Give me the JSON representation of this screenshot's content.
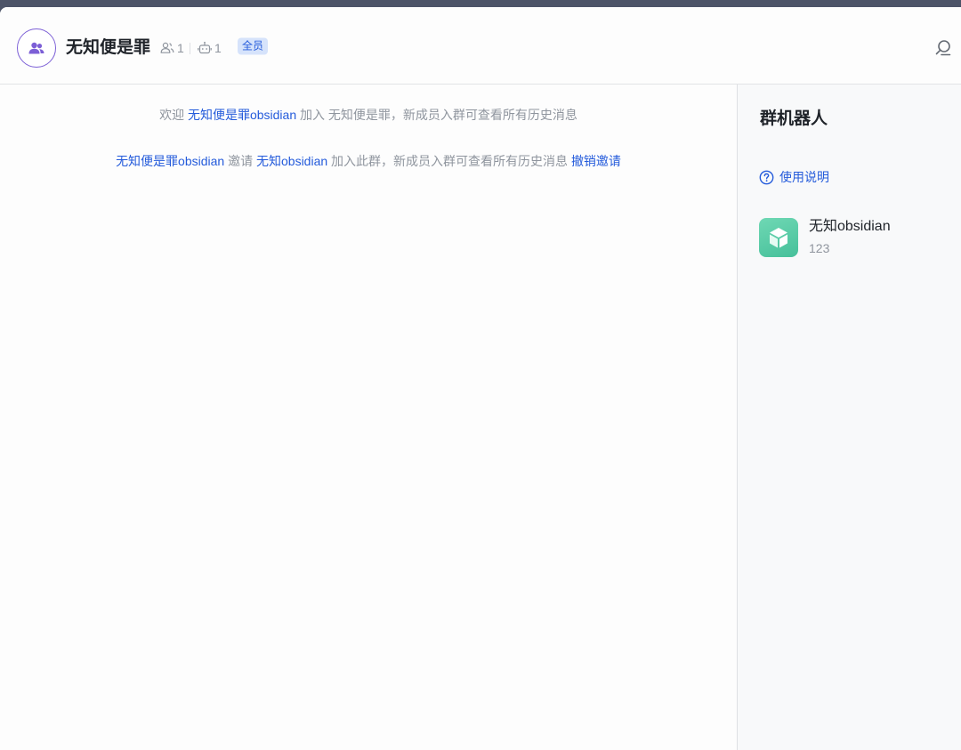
{
  "header": {
    "group_name": "无知便是罪",
    "member_count": "1",
    "bot_count": "1",
    "badge": "全员"
  },
  "chat": {
    "messages": [
      {
        "prefix": "欢迎 ",
        "user": "无知便是罪obsidian",
        "suffix": " 加入 无知便是罪，新成员入群可查看所有历史消息"
      },
      {
        "inviter": "无知便是罪obsidian",
        "invite_word": " 邀请 ",
        "invitee": "无知obsidian",
        "suffix": " 加入此群，新成员入群可查看所有历史消息 ",
        "revoke": "撤销邀请"
      }
    ]
  },
  "sidebar": {
    "title": "群机器人",
    "help_label": "使用说明",
    "bots": [
      {
        "name": "无知obsidian",
        "description": "123"
      }
    ]
  },
  "colors": {
    "accent": "#245bdb",
    "avatar_ring": "#7c5fd6",
    "bot_avatar": "#52c7a0"
  }
}
